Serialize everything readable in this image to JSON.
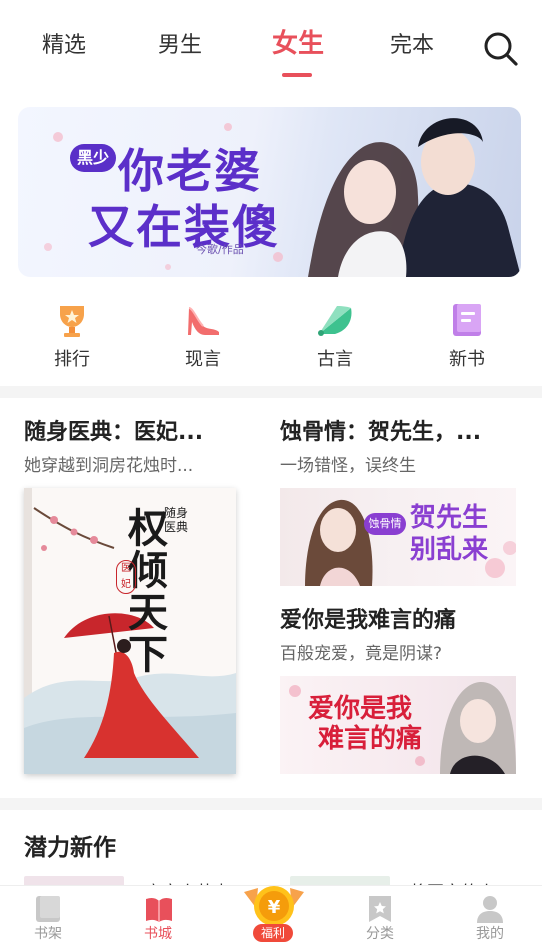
{
  "top_tabs": [
    {
      "label": "精选"
    },
    {
      "label": "男生"
    },
    {
      "label": "女生"
    },
    {
      "label": "完本"
    }
  ],
  "active_tab": "女生",
  "banner": {
    "title_line1": "你老婆",
    "title_line2": "又在装傻",
    "prefix": "黑少",
    "author": "今歌/作品"
  },
  "categories": [
    {
      "label": "排行",
      "icon": "trophy-icon"
    },
    {
      "label": "现言",
      "icon": "high-heel-icon"
    },
    {
      "label": "古言",
      "icon": "fan-icon"
    },
    {
      "label": "新书",
      "icon": "new-book-icon"
    }
  ],
  "featured": {
    "left": {
      "title": "随身医典：医妃...",
      "desc": "她穿越到洞房花烛时...",
      "cover_text": "权倾天下",
      "cover_sub": "随身医典",
      "cover_tag": "医妃"
    },
    "right_top": {
      "title": "蚀骨情：贺先生，...",
      "desc": "一场错怪，误终生",
      "cover_text": "贺先生别乱来",
      "cover_tag": "蚀骨情"
    },
    "right_bottom": {
      "title": "爱你是我难言的痛",
      "desc": "百般宠爱，竟是阴谋?",
      "cover_text_1": "爱你是我",
      "cover_text_2": "难言的痛"
    }
  },
  "section": {
    "title": "潜力新作"
  },
  "peek": {
    "left": "蜜宠小萌妻",
    "right": "将军家的小"
  },
  "bottom_nav": {
    "items": [
      {
        "label": "书架",
        "icon": "bookshelf-icon"
      },
      {
        "label": "书城",
        "icon": "bookstore-icon"
      },
      {
        "label": "福利",
        "icon": "welfare-coin-icon"
      },
      {
        "label": "分类",
        "icon": "category-icon"
      },
      {
        "label": "我的",
        "icon": "profile-icon"
      }
    ],
    "active": "书城"
  },
  "colors": {
    "accent": "#e8505b",
    "divider": "#f4f4f4",
    "muted": "#999999"
  }
}
